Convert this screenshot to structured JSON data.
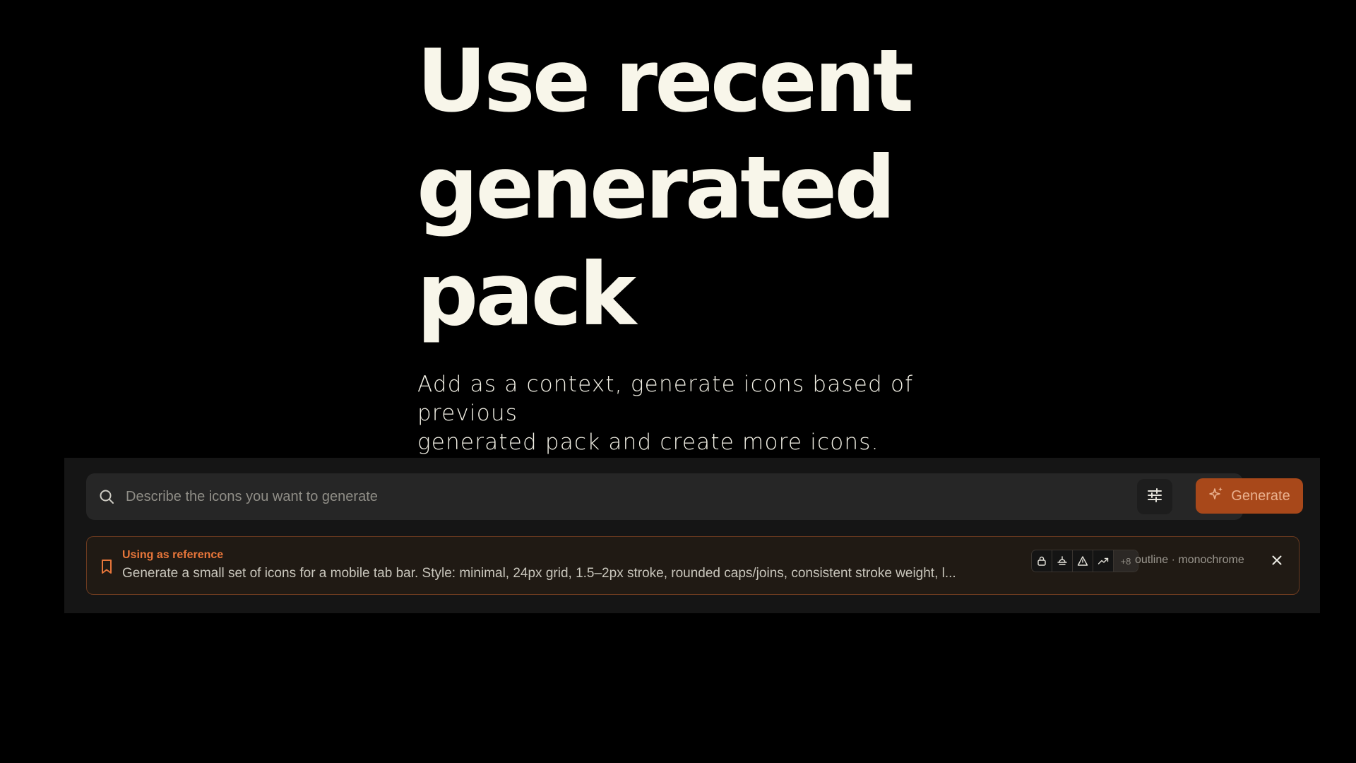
{
  "hero": {
    "title_line1": "Use recent",
    "title_line2": "generated",
    "title_line3": "pack",
    "subtitle_line1": "Add as a context, generate icons based of previous",
    "subtitle_line2": "generated pack and create more icons."
  },
  "search": {
    "placeholder": "Describe the icons you want to generate",
    "icon": "search-icon",
    "filter_icon": "sliders-icon"
  },
  "generate_button": {
    "label": "Generate",
    "icon": "sparkles-icon",
    "color": "#a8481a"
  },
  "reference": {
    "label": "Using as reference",
    "prompt": "Generate a small set of icons for a mobile tab bar. Style: minimal, 24px grid, 1.5–2px stroke, rounded caps/joins, consistent stroke weight, l...",
    "style": "outline · monochrome",
    "more_count": "+8",
    "preview_icons": [
      "lock-icon",
      "sunrise-icon",
      "warning-triangle-icon",
      "trending-up-icon"
    ],
    "accent_color": "#e8763a"
  },
  "colors": {
    "background": "#000000",
    "panel": "#151515",
    "text": "#f8f6ea"
  }
}
